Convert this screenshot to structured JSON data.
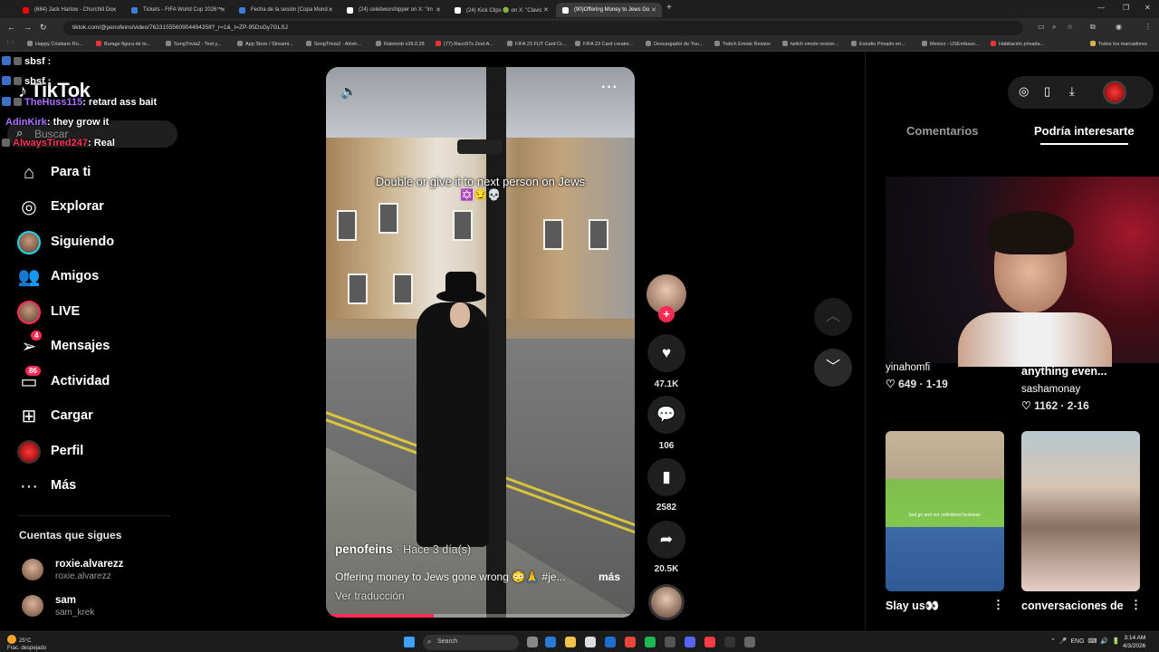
{
  "browser": {
    "tabs": [
      {
        "label": "(684) Jack Harlow - Churchill Do",
        "favicon_color": "#ff0000"
      },
      {
        "label": "Tickets - FIFA World Cup 2026™",
        "favicon_color": "#3b7dd8"
      },
      {
        "label": "Fecha de la sesión [Copa Mund",
        "favicon_color": "#3b7dd8"
      },
      {
        "label": "(24) celebworshipper on X: \"im",
        "favicon_color": "#ffffff"
      },
      {
        "label": "(24) Kick Clips 🟢 on X: \"Clavic",
        "favicon_color": "#ffffff"
      },
      {
        "label": "(90)Offering Money to Jews Go",
        "favicon_color": "#ffffff"
      }
    ],
    "url": "tiktok.com/@penofeins/video/7623155560904494358?_r=1&_t=ZP-95DsGy7GLSJ",
    "bookmarks": [
      "Happy Cristiano Ro...",
      "Burago figura de to...",
      "SongTrivia2 - Test y...",
      "App Store / Streami...",
      "SongTrivia2 - Advin...",
      "Raletoob v28.0.28",
      "(77) Raco97s Zesl-A...",
      "FIFA 23 FUT Card Cr...",
      "FIFA 23 Card creator...",
      "Descargador de You...",
      "Twitch Emote Resizer",
      "twitch emote resizer...",
      "Estudio Privado en...",
      "Mexico - USEmbass...",
      "Habitación privada...",
      "Todos los marcadores"
    ]
  },
  "chat_overlay": [
    {
      "user": "sbsf",
      "msg": "",
      "color": "#ffffff"
    },
    {
      "user": "sbsf",
      "msg": "",
      "color": "#ffffff"
    },
    {
      "user": "TheHuss115",
      "msg": ": retard ass bait",
      "color": "#a970ff"
    },
    {
      "user": "AdinKirk",
      "msg": ": they grow it",
      "color": "#a970ff"
    },
    {
      "user": "AlwaysTired247",
      "msg": ": Real",
      "color": "#ff3355"
    }
  ],
  "sidebar": {
    "logo": "TikTok",
    "search_placeholder": "Buscar",
    "items": [
      {
        "label": "Para ti",
        "icon": "home-icon"
      },
      {
        "label": "Explorar",
        "icon": "compass-icon"
      },
      {
        "label": "Siguiendo",
        "icon": "following-avatar"
      },
      {
        "label": "Amigos",
        "icon": "friends-icon"
      },
      {
        "label": "LIVE",
        "icon": "live-avatar"
      },
      {
        "label": "Mensajes",
        "icon": "messages-icon",
        "badge": "4"
      },
      {
        "label": "Actividad",
        "icon": "activity-icon",
        "badge": "86"
      },
      {
        "label": "Cargar",
        "icon": "upload-icon"
      },
      {
        "label": "Perfil",
        "icon": "profile-avatar"
      },
      {
        "label": "Más",
        "icon": "more-icon"
      }
    ],
    "following_title": "Cuentas que sigues",
    "following": [
      {
        "name": "roxie.alvarezz",
        "handle": "roxie.alvarezz"
      },
      {
        "name": "sam",
        "handle": "sam_krek"
      }
    ]
  },
  "video": {
    "caption": "Double or give it to next person on Jews",
    "caption_emoji": "✡️😏💀",
    "author": "penofeins",
    "posted": "· Hace 3 día(s)",
    "description": "Offering money to Jews gone wrong 😳🙏 #je...",
    "more_label": "más",
    "translate_label": "Ver traducción",
    "progress": 0.35
  },
  "actions": {
    "likes": "47.1K",
    "comments": "106",
    "saves": "2582",
    "shares": "20.5K"
  },
  "right_panel": {
    "tabs": [
      "Comentarios",
      "Podría interesarte"
    ],
    "active_tab": 1,
    "cards": [
      {
        "name": "yinahomfi",
        "meta": "♡ 649 · 1-19"
      },
      {
        "title": "anything even...",
        "name": "sashamonay",
        "meta": "♡ 1162 · 2-16"
      },
      {
        "title": "Slay us👀",
        "overlay": "Just go and our unfinished business"
      },
      {
        "title": "conversaciones de"
      }
    ]
  },
  "taskbar": {
    "weather_temp": "25°C",
    "weather_desc": "Frac. despejado",
    "search_label": "Search",
    "lang": "ENG",
    "time": "3:14 AM",
    "date": "4/3/2026"
  }
}
